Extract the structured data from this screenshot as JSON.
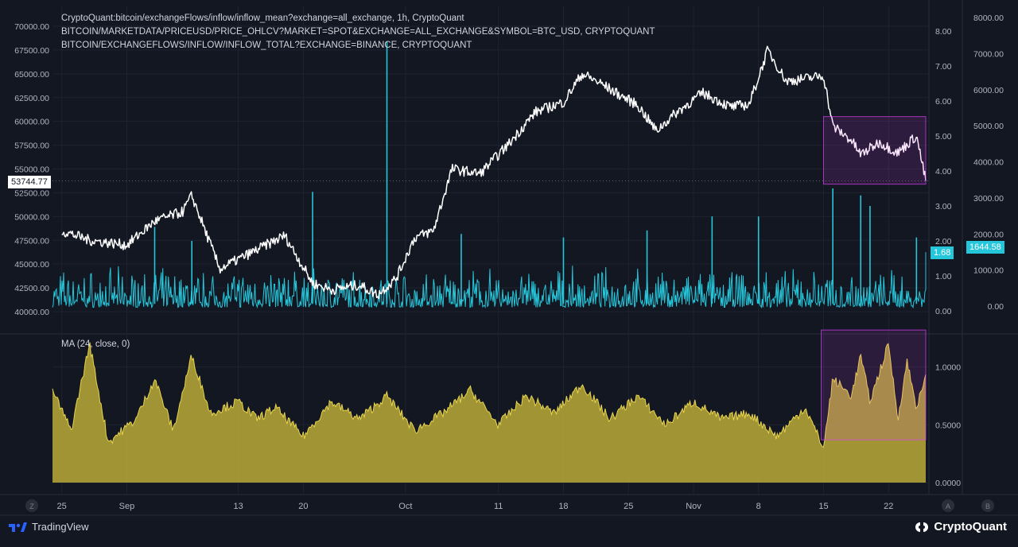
{
  "legend": {
    "line1": "CryptoQuant:bitcoin/exchangeFlows/inflow/inflow_mean?exchange=all_exchange, 1h, CryptoQuant",
    "line2": "BITCOIN/MARKETDATA/PRICEUSD/PRICE_OHLCV?MARKET=SPOT&EXCHANGE=ALL_EXCHANGE&SYMBOL=BTC_USD, CRYPTOQUANT",
    "line3": "BITCOIN/EXCHANGEFLOWS/INFLOW/INFLOW_TOTAL?EXCHANGE=BINANCE, CRYPTOQUANT"
  },
  "ma_legend": "MA (24, close, 0)",
  "tags": {
    "price": "53744.77",
    "inflow_mean": "1.68",
    "binance_total": "1644.58"
  },
  "footer": {
    "tradingview": "TradingView",
    "cryptoquant": "CryptoQuant"
  },
  "scale_buttons": {
    "left": "Z",
    "right1": "A",
    "right2": "B"
  },
  "colors": {
    "background": "#131722",
    "price": "#ffffff",
    "inflow": "#26c6da",
    "ma_fill": "#c9b73a",
    "highlight": "#e040fb",
    "price_tag_bg": "#ffffff",
    "inflow_tag_bg": "#26c6da"
  },
  "chart_data": [
    {
      "type": "line",
      "title": "",
      "axes": {
        "price_left": {
          "ticks": [
            "70000.00",
            "67500.00",
            "65000.00",
            "62500.00",
            "60000.00",
            "57500.00",
            "55000.00",
            "52500.00",
            "50000.00",
            "47500.00",
            "45000.00",
            "42500.00",
            "40000.00"
          ],
          "range": [
            40000,
            70000
          ]
        },
        "inflow_mean_right": {
          "ticks": [
            "8.00",
            "7.00",
            "6.00",
            "5.00",
            "4.00",
            "3.00",
            "2.00",
            "1.00",
            "0.00"
          ],
          "range": [
            0,
            8
          ]
        },
        "binance_total_far_right": {
          "ticks": [
            "8000.00",
            "7000.00",
            "6000.00",
            "5000.00",
            "4000.00",
            "3000.00",
            "2000.00",
            "1000.00",
            "0.00"
          ],
          "range": [
            0,
            8000
          ]
        }
      },
      "x_ticks": [
        "25",
        "Sep",
        "13",
        "20",
        "Oct",
        "11",
        "18",
        "25",
        "Nov",
        "8",
        "15",
        "22"
      ],
      "series": [
        {
          "name": "BITCOIN/MARKETDATA/PRICEUSD/PRICE_OHLCV?MARKET=SPOT&EXCHANGE=ALL_EXCHANGE&SYMBOL=BTC_USD, CRYPTOQUANT",
          "x": [
            "Aug 25",
            "Aug 28",
            "Sep 1",
            "Sep 4",
            "Sep 7",
            "Sep 8",
            "Sep 11",
            "Sep 15",
            "Sep 18",
            "Sep 21",
            "Sep 23",
            "Sep 26",
            "Sep 28",
            "Sep 30",
            "Oct 2",
            "Oct 4",
            "Oct 6",
            "Oct 9",
            "Oct 12",
            "Oct 15",
            "Oct 18",
            "Oct 20",
            "Oct 22",
            "Oct 24",
            "Oct 26",
            "Oct 28",
            "Oct 30",
            "Nov 2",
            "Nov 5",
            "Nov 7",
            "Nov 9",
            "Nov 11",
            "Nov 13",
            "Nov 15",
            "Nov 16",
            "Nov 18",
            "Nov 19",
            "Nov 21",
            "Nov 23",
            "Nov 25",
            "Nov 26"
          ],
          "y": [
            48500,
            47500,
            47000,
            49500,
            50500,
            52200,
            44500,
            46500,
            48000,
            43000,
            42300,
            42800,
            41800,
            43500,
            47800,
            48500,
            55000,
            54500,
            57500,
            61000,
            62000,
            65000,
            64000,
            62800,
            61700,
            59000,
            60800,
            63000,
            61500,
            61800,
            67500,
            64200,
            64500,
            64800,
            59500,
            58000,
            56500,
            57800,
            56700,
            58500,
            53744.77
          ],
          "color": "#ffffff"
        },
        {
          "name": "CryptoQuant:bitcoin/exchangeFlows/inflow/inflow_mean?exchange=all_exchange, 1h, CryptoQuant",
          "baseline_range": [
            0.1,
            1.1
          ],
          "spikes": [
            {
              "x": "Sep 4",
              "y": 2.4
            },
            {
              "x": "Sep 8",
              "y": 2.0
            },
            {
              "x": "Sep 21",
              "y": 3.4
            },
            {
              "x": "Sep 29",
              "y": 7.7
            },
            {
              "x": "Oct 7",
              "y": 2.2
            },
            {
              "x": "Oct 18",
              "y": 2.1
            },
            {
              "x": "Oct 27",
              "y": 2.3
            },
            {
              "x": "Nov 3",
              "y": 2.7
            },
            {
              "x": "Nov 8",
              "y": 2.7
            },
            {
              "x": "Nov 16",
              "y": 3.5
            },
            {
              "x": "Nov 19",
              "y": 3.3
            },
            {
              "x": "Nov 20",
              "y": 3.0
            },
            {
              "x": "Nov 25",
              "y": 2.1
            }
          ],
          "last": 1.68,
          "color": "#26c6da"
        }
      ],
      "annotation": {
        "type": "rectangle",
        "from": [
          "Nov 15",
          60500
        ],
        "to": [
          "Nov 26",
          53400
        ],
        "color": "#e040fb"
      }
    },
    {
      "type": "area",
      "title": "MA (24, close, 0)",
      "y_ticks": [
        "1.0000",
        "0.5000",
        "0.0000"
      ],
      "ylim": [
        0,
        1.3
      ],
      "x": [
        "Aug 24",
        "Aug 26",
        "Aug 28",
        "Aug 30",
        "Sep 2",
        "Sep 4",
        "Sep 6",
        "Sep 8",
        "Sep 10",
        "Sep 13",
        "Sep 15",
        "Sep 17",
        "Sep 20",
        "Sep 23",
        "Sep 26",
        "Sep 29",
        "Oct 2",
        "Oct 5",
        "Oct 8",
        "Oct 11",
        "Oct 14",
        "Oct 17",
        "Oct 20",
        "Oct 23",
        "Oct 26",
        "Oct 29",
        "Nov 1",
        "Nov 4",
        "Nov 7",
        "Nov 10",
        "Nov 13",
        "Nov 15",
        "Nov 16",
        "Nov 18",
        "Nov 19",
        "Nov 20",
        "Nov 22",
        "Nov 23",
        "Nov 24",
        "Nov 25",
        "Nov 26"
      ],
      "y": [
        0.8,
        0.45,
        1.2,
        0.35,
        0.55,
        0.9,
        0.45,
        1.1,
        0.6,
        0.7,
        0.55,
        0.65,
        0.4,
        0.7,
        0.55,
        0.75,
        0.45,
        0.6,
        0.8,
        0.5,
        0.75,
        0.6,
        0.85,
        0.55,
        0.75,
        0.5,
        0.7,
        0.55,
        0.6,
        0.4,
        0.65,
        0.3,
        0.9,
        0.75,
        1.1,
        0.7,
        1.2,
        0.55,
        1.05,
        0.65,
        0.9
      ],
      "color": "#c9b73a",
      "annotation": {
        "type": "rectangle",
        "from": [
          "Nov 15",
          1.32
        ],
        "to": [
          "Nov 26",
          0.37
        ],
        "color": "#e040fb"
      }
    }
  ]
}
